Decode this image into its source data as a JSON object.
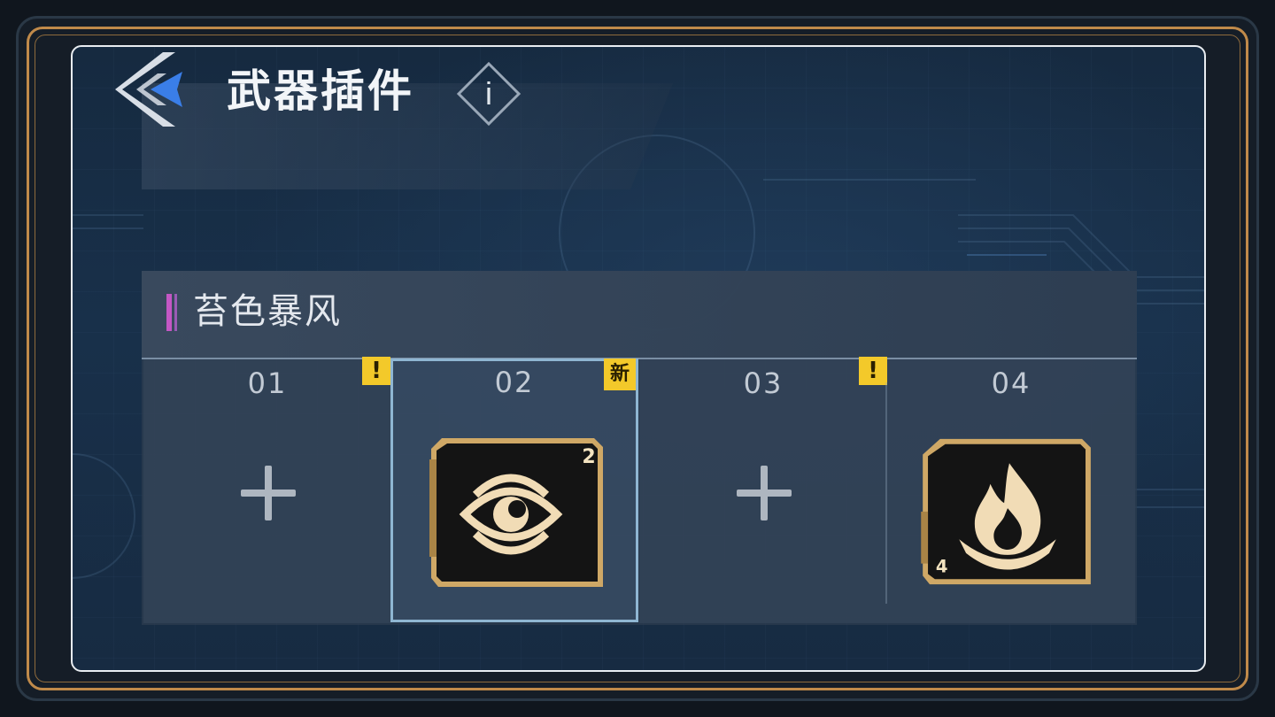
{
  "title": "武器插件",
  "info_label": "i",
  "weapon": {
    "name": "苔色暴风"
  },
  "slots": [
    {
      "number": "01",
      "badge": "!",
      "state": "empty"
    },
    {
      "number": "02",
      "badge": "新",
      "state": "equipped",
      "selected": true,
      "plugin_icon": "eye-icon",
      "level": "2"
    },
    {
      "number": "03",
      "badge": "!",
      "state": "empty"
    },
    {
      "number": "04",
      "badge": "",
      "state": "equipped",
      "plugin_icon": "flame-icon",
      "level": "4"
    }
  ],
  "colors": {
    "accent_gold": "#c08a4a",
    "badge_yellow": "#f3c92a",
    "weapon_tag": "#c457c4",
    "selection": "#8fb6d2",
    "back_blue": "#3a7ee8"
  }
}
